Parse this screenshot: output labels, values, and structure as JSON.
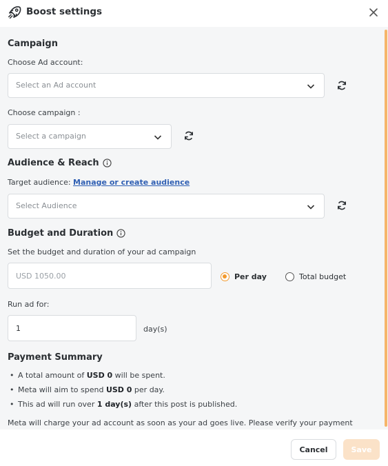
{
  "header": {
    "title": "Boost settings",
    "icon": "rocket-icon",
    "close_icon": "close-icon"
  },
  "campaign": {
    "section_title": "Campaign",
    "ad_account_label": "Choose Ad account:",
    "ad_account_placeholder": "Select an Ad account",
    "campaign_label": "Choose campaign :",
    "campaign_placeholder": "Select a campaign"
  },
  "audience": {
    "section_title": "Audience & Reach",
    "target_label": "Target audience:",
    "target_link": "Manage or create audience",
    "placeholder": "Select Audience"
  },
  "budget": {
    "section_title": "Budget and Duration",
    "description": "Set the budget and duration of your ad campaign",
    "budget_placeholder": "USD 1050.00",
    "radio_per_day": "Per day",
    "radio_total": "Total budget",
    "selected": "Per day",
    "run_label": "Run ad for:",
    "run_value": "1",
    "run_unit": "day(s)"
  },
  "payment": {
    "section_title": "Payment Summary",
    "bullets": [
      {
        "pre": "A total amount of ",
        "bold": "USD 0",
        "post": " will be spent."
      },
      {
        "pre": "Meta will aim to spend ",
        "bold": "USD 0",
        "post": " per day."
      },
      {
        "pre": "This ad will run over ",
        "bold": "1 day(s)",
        "post": " after this post is published."
      }
    ],
    "note": "Meta will charge your ad account as soon as your ad goes live. Please verify your payment"
  },
  "footer": {
    "cancel_label": "Cancel",
    "save_label": "Save"
  },
  "colors": {
    "accent": "#f29a2e",
    "save_disabled_bg": "#fbe2c8",
    "link": "#2f5fb3",
    "body_bg": "#f5f6f7"
  }
}
